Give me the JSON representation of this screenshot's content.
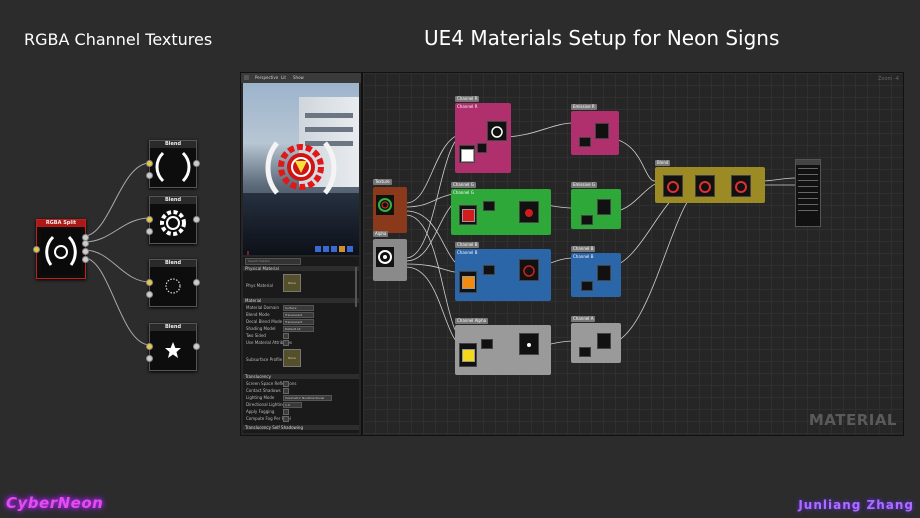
{
  "titles": {
    "left": "RGBA Channel Textures",
    "main": "UE4 Materials Setup for Neon Signs"
  },
  "branding": {
    "left": "CyberNeon",
    "right": "Junliang Zhang"
  },
  "mini_graph": {
    "source_node": "RGBA Split",
    "blend_nodes": [
      "Blend",
      "Blend",
      "Blend",
      "Blend"
    ]
  },
  "editor": {
    "viewport_toolbar": {
      "perspective": "Perspective",
      "lit": "Lit",
      "show": "Show"
    },
    "details": {
      "search_placeholder": "Search Details",
      "sections": {
        "physical_material": "Physical Material",
        "material": "Material",
        "translucency": "Translucency",
        "translucency_shadow": "Translucency Self Shadowing"
      },
      "rows": {
        "phys_material": "Phys Material",
        "none": "None",
        "material_domain": "Material Domain",
        "material_domain_val": "Surface",
        "blend_mode": "Blend Mode",
        "blend_mode_val": "Translucent",
        "decal_blend_mode": "Decal Blend Mode",
        "decal_blend_mode_val": "Translucent",
        "shading_model": "Shading Model",
        "shading_model_val": "Default Lit",
        "two_sided": "Two Sided",
        "use_material_attributes": "Use Material Attributes",
        "subsurface_profile": "Subsurface Profile",
        "screen_space_reflections": "Screen Space Reflections",
        "contact_shadows": "Contact Shadows",
        "lighting_mode": "Lighting Mode",
        "lighting_mode_val": "Volumetric NonDirectional",
        "directional_lighting": "Directional Lighting Inte",
        "directional_lighting_val": "1.0",
        "apply_fogging": "Apply Fogging",
        "compute_fog_per_pixel": "Compute Fog Per Pixel"
      }
    },
    "graph": {
      "zoom": "Zoom -4",
      "watermark": "MATERIAL",
      "comments": {
        "channel_r": "Channel R",
        "channel_g": "Channel G",
        "channel_b": "Channel B",
        "channel_alpha": "Channel Alpha"
      },
      "tags": {
        "channel_r_top": "Channel R",
        "emissive_r": "Emissive R",
        "channel_g_tag": "Channel G",
        "emissive_g": "Emissive G",
        "channel_b_tag": "Channel B",
        "channel_b2": "Channel B",
        "channel_a_tag": "Channel Alpha",
        "channel_a2": "Channel A",
        "texture": "Texture",
        "alpha": "Alpha",
        "blend": "Blend"
      }
    }
  },
  "colors": {
    "red": "#d01c1c",
    "green": "#2fb53a",
    "blue": "#2a66a8",
    "magenta": "#c0307e",
    "olive": "#9c8a25",
    "orange_texture": "#b84c1c",
    "alpha_node": "#9a9a9a",
    "brand_pink": "#e24fe6",
    "brand_purple": "#b06cff"
  }
}
